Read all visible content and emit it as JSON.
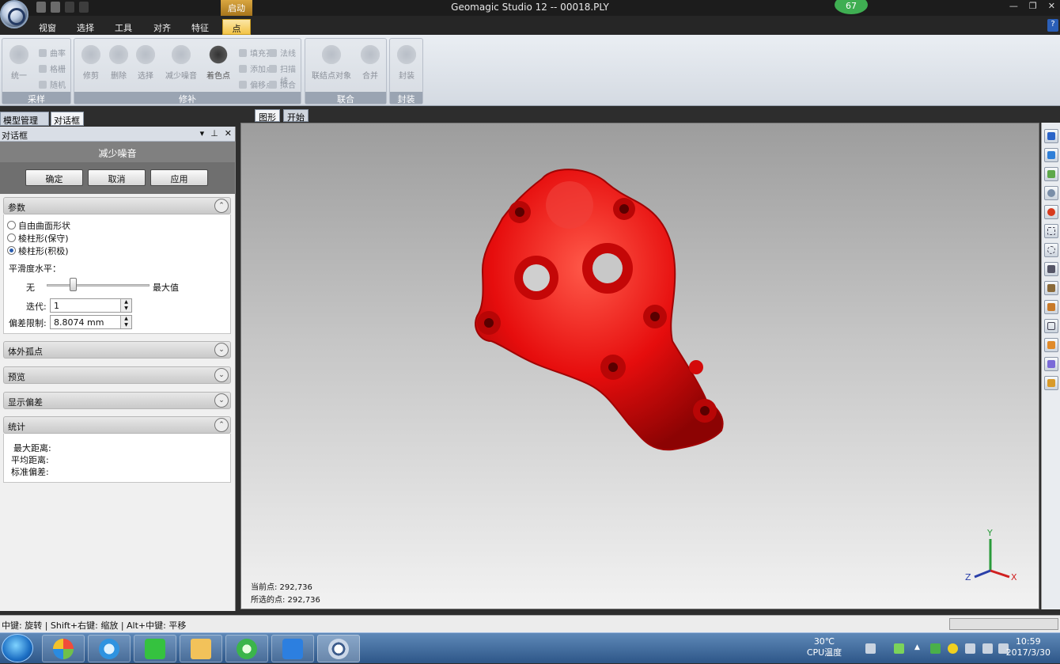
{
  "window": {
    "title": "Geomagic Studio 12 -- 00018.PLY",
    "context_tab": "启动",
    "notification_badge": "67",
    "help_label": "?",
    "controls": {
      "minimize": "—",
      "restore": "❐",
      "close": "✕"
    }
  },
  "ribbon": {
    "tabs": [
      {
        "label": "视窗",
        "active": false
      },
      {
        "label": "选择",
        "active": false
      },
      {
        "label": "工具",
        "active": false
      },
      {
        "label": "对齐",
        "active": false
      },
      {
        "label": "特征",
        "active": false
      },
      {
        "label": "点",
        "active": true
      }
    ],
    "groups": {
      "sampling": {
        "label": "采样",
        "big": "统一",
        "small": [
          "曲率",
          "格栅",
          "随机"
        ]
      },
      "repair": {
        "label": "修补",
        "big": [
          "修剪",
          "删除",
          "选择",
          "减少噪音",
          "着色点"
        ],
        "small": [
          "填充孔",
          "添加点",
          "偏移点",
          "法线",
          "扫描线",
          "拟合"
        ]
      },
      "combine": {
        "label": "联合",
        "big": [
          "联结点对象",
          "合并"
        ]
      },
      "wrap": {
        "label": "封装",
        "big": "封装"
      }
    }
  },
  "panel": {
    "tabs": [
      "模型管理器",
      "对话框"
    ],
    "header": "对话框",
    "header_controls": [
      "▾",
      "⊥",
      "✕"
    ],
    "command_title": "减少噪音",
    "buttons": {
      "ok": "确定",
      "cancel": "取消",
      "apply": "应用"
    },
    "params": {
      "title": "参数",
      "options": [
        {
          "label": "自由曲面形状",
          "selected": false
        },
        {
          "label": "棱柱形(保守)",
          "selected": false
        },
        {
          "label": "棱柱形(积极)",
          "selected": true
        }
      ],
      "smoothness_label": "平滑度水平：",
      "slider_min": "无",
      "slider_max": "最大值",
      "slider_level": 0.25,
      "iterations_label": "迭代:",
      "iterations_value": "1",
      "deviation_label": "偏差限制:",
      "deviation_value": "8.8074 mm"
    },
    "collapsed_sections": [
      "体外孤点",
      "预览",
      "显示偏差"
    ],
    "stats": {
      "title": "统计",
      "max_distance": "最大距离:",
      "avg_distance": "平均距离:",
      "std_dev": "标准偏差:"
    },
    "expand_icon": "⌄",
    "collapse_icon": "⌃"
  },
  "viewport": {
    "tabs": [
      {
        "label": "图形",
        "active": true
      },
      {
        "label": "开始",
        "active": false
      }
    ],
    "current_points": "当前点: 292,736",
    "selected_points": "所选的点: 292,736",
    "model_color": "#e60d0d",
    "axes": {
      "x": "X",
      "y": "Y",
      "z": "Z"
    }
  },
  "statusbar": {
    "hint": "中键: 旋转 | Shift+右键: 缩放 | Alt+中键: 平移"
  },
  "taskbar": {
    "apps": [
      "media-center",
      "ie-browser",
      "iqiyi",
      "file-explorer",
      "360-browser",
      "wps-writer",
      "geomagic-studio"
    ],
    "temperature": "30℃",
    "temperature_label": "CPU温度",
    "time": "10:59",
    "date": "2017/3/30"
  }
}
